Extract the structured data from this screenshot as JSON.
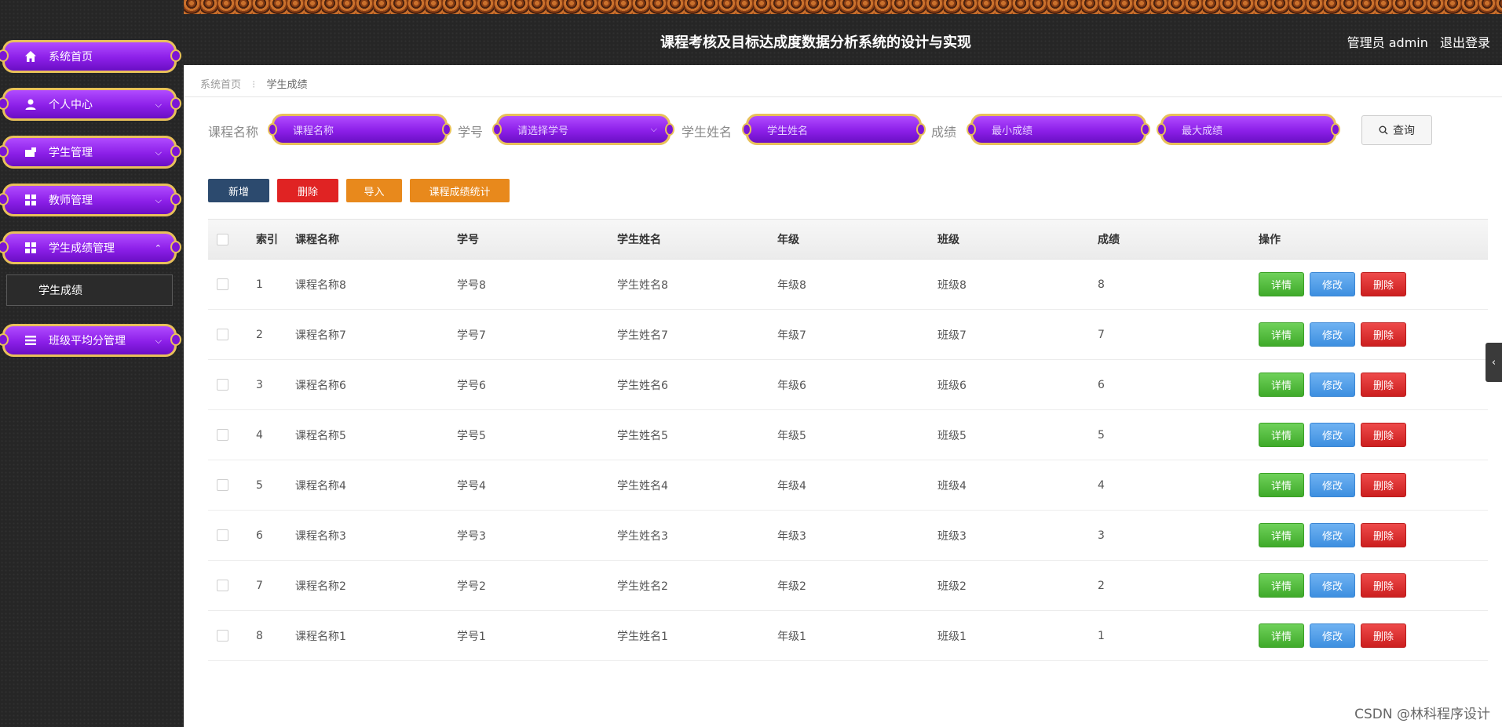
{
  "header": {
    "title": "课程考核及目标达成度数据分析系统的设计与实现",
    "user_label": "管理员 admin",
    "logout": "退出登录"
  },
  "sidebar": {
    "items": [
      {
        "label": "系统首页",
        "icon": "home-icon",
        "chevron": ""
      },
      {
        "label": "个人中心",
        "icon": "user-icon",
        "chevron": "⌵"
      },
      {
        "label": "学生管理",
        "icon": "id-card-icon",
        "chevron": "⌵"
      },
      {
        "label": "教师管理",
        "icon": "grid-icon",
        "chevron": "⌵"
      },
      {
        "label": "学生成绩管理",
        "icon": "grid-icon",
        "chevron": "⌃"
      },
      {
        "label": "班级平均分管理",
        "icon": "list-icon",
        "chevron": "⌵"
      }
    ],
    "sub_item": "学生成绩"
  },
  "breadcrumb": {
    "home": "系统首页",
    "separator": "⁝",
    "current": "学生成绩"
  },
  "search": {
    "course_label": "课程名称",
    "course_placeholder": "课程名称",
    "student_id_label": "学号",
    "student_id_placeholder": "请选择学号",
    "student_name_label": "学生姓名",
    "student_name_placeholder": "学生姓名",
    "score_label": "成绩",
    "min_score_placeholder": "最小成绩",
    "max_score_placeholder": "最大成绩",
    "query_button": "查询"
  },
  "actions": {
    "add": "新增",
    "delete": "删除",
    "import": "导入",
    "stats": "课程成绩统计"
  },
  "table": {
    "headers": [
      "索引",
      "课程名称",
      "学号",
      "学生姓名",
      "年级",
      "班级",
      "成绩",
      "操作"
    ],
    "rows": [
      {
        "index": "1",
        "course": "课程名称8",
        "student_id": "学号8",
        "name": "学生姓名8",
        "grade": "年级8",
        "class": "班级8",
        "score": "8"
      },
      {
        "index": "2",
        "course": "课程名称7",
        "student_id": "学号7",
        "name": "学生姓名7",
        "grade": "年级7",
        "class": "班级7",
        "score": "7"
      },
      {
        "index": "3",
        "course": "课程名称6",
        "student_id": "学号6",
        "name": "学生姓名6",
        "grade": "年级6",
        "class": "班级6",
        "score": "6"
      },
      {
        "index": "4",
        "course": "课程名称5",
        "student_id": "学号5",
        "name": "学生姓名5",
        "grade": "年级5",
        "class": "班级5",
        "score": "5"
      },
      {
        "index": "5",
        "course": "课程名称4",
        "student_id": "学号4",
        "name": "学生姓名4",
        "grade": "年级4",
        "class": "班级4",
        "score": "4"
      },
      {
        "index": "6",
        "course": "课程名称3",
        "student_id": "学号3",
        "name": "学生姓名3",
        "grade": "年级3",
        "class": "班级3",
        "score": "3"
      },
      {
        "index": "7",
        "course": "课程名称2",
        "student_id": "学号2",
        "name": "学生姓名2",
        "grade": "年级2",
        "class": "班级2",
        "score": "2"
      },
      {
        "index": "8",
        "course": "课程名称1",
        "student_id": "学号1",
        "name": "学生姓名1",
        "grade": "年级1",
        "class": "班级1",
        "score": "1"
      }
    ],
    "row_buttons": {
      "detail": "详情",
      "edit": "修改",
      "delete": "删除"
    }
  },
  "colors": {
    "pill_purple": "#8c1fe8",
    "pill_gold": "#e8c05a",
    "add_button": "#2c4a6e",
    "delete_button": "#e02323",
    "import_button": "#e8891c",
    "detail_button": "#4cbb36",
    "edit_button": "#4b9be8",
    "row_delete_button": "#d62828"
  },
  "watermark": "CSDN @林科程序设计"
}
